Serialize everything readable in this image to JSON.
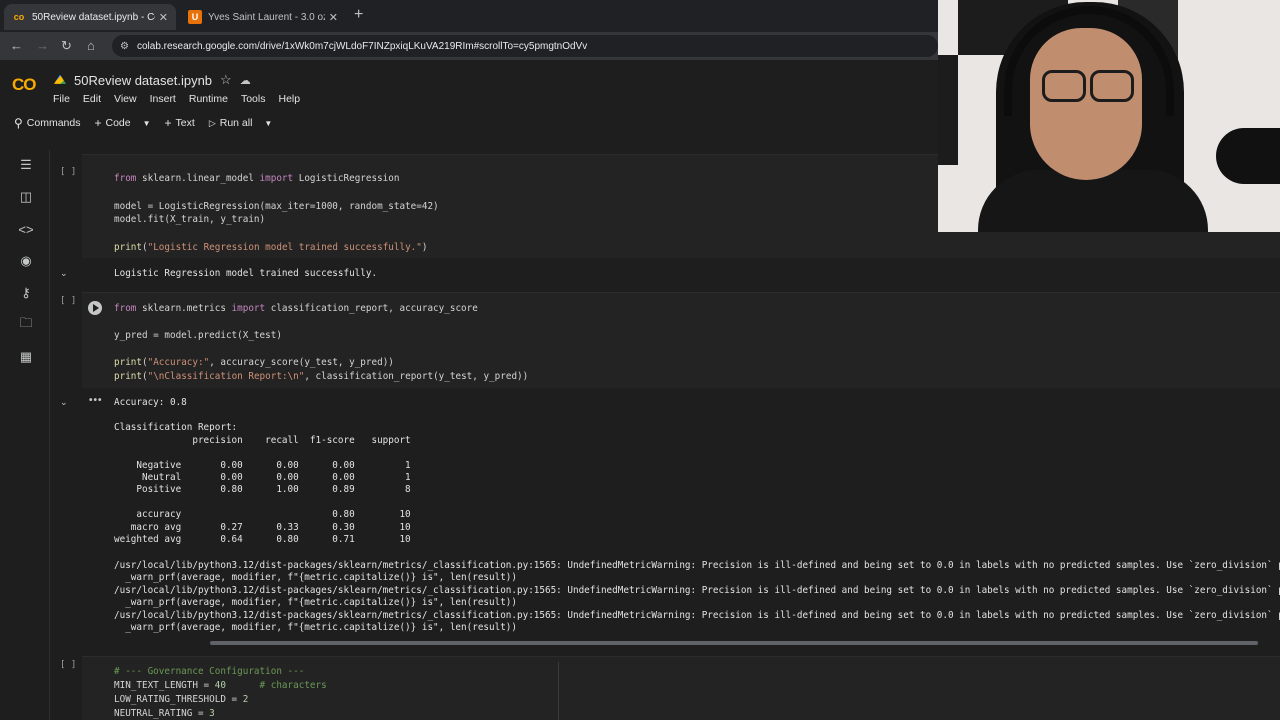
{
  "browser": {
    "tabs": [
      {
        "title": "50Review dataset.ipynb - Colab",
        "active": true
      },
      {
        "title": "Yves Saint Laurent - 3.0 oz Blac",
        "active": false
      }
    ],
    "new_tab_symbol": "+",
    "close_symbol": "✕",
    "url": "colab.research.google.com/drive/1xWk0m7cjWLdoF7INZpxiqLKuVA219RIm#scrollTo=cy5pmgtnOdVv"
  },
  "colab": {
    "logo": "CO",
    "notebook_title": "50Review dataset.ipynb",
    "menus": [
      "File",
      "Edit",
      "View",
      "Insert",
      "Runtime",
      "Tools",
      "Help"
    ],
    "toolbar": {
      "commands": "Commands",
      "code": "Code",
      "text": "Text",
      "run_all": "Run all"
    }
  },
  "cells": {
    "cell1": {
      "bracket": "[ ]",
      "lines": [
        "from sklearn.linear_model import LogisticRegression",
        "model = LogisticRegression(max_iter=1000, random_state=42)",
        "model.fit(X_train, y_train)",
        "print(\"Logistic Regression model trained successfully.\")"
      ],
      "output": "Logistic Regression model trained successfully."
    },
    "cell2": {
      "bracket": "[ ]",
      "lines": [
        "from sklearn.metrics import classification_report, accuracy_score",
        "y_pred = model.predict(X_test)",
        "print(\"Accuracy:\", accuracy_score(y_test, y_pred))",
        "print(\"\\nClassification Report:\\n\", classification_report(y_test, y_pred))"
      ],
      "output_lines": [
        "Accuracy: 0.8",
        "Classification Report:",
        "              precision    recall  f1-score   support",
        "    Negative       0.00      0.00      0.00         1",
        "     Neutral       0.00      0.00      0.00         1",
        "    Positive       0.80      1.00      0.89         8",
        "    accuracy                           0.80        10",
        "   macro avg       0.27      0.33      0.30        10",
        "weighted avg       0.64      0.80      0.71        10",
        "/usr/local/lib/python3.12/dist-packages/sklearn/metrics/_classification.py:1565: UndefinedMetricWarning: Precision is ill-defined and being set to 0.0 in labels with no predicted samples. Use `zero_division` pa",
        "  _warn_prf(average, modifier, f\"{metric.capitalize()} is\", len(result))",
        "/usr/local/lib/python3.12/dist-packages/sklearn/metrics/_classification.py:1565: UndefinedMetricWarning: Precision is ill-defined and being set to 0.0 in labels with no predicted samples. Use `zero_division` pa",
        "  _warn_prf(average, modifier, f\"{metric.capitalize()} is\", len(result))",
        "/usr/local/lib/python3.12/dist-packages/sklearn/metrics/_classification.py:1565: UndefinedMetricWarning: Precision is ill-defined and being set to 0.0 in labels with no predicted samples. Use `zero_division` pa",
        "  _warn_prf(average, modifier, f\"{metric.capitalize()} is\", len(result))"
      ]
    },
    "cell3": {
      "bracket": "[ ]",
      "lines": [
        "# --- Governance Configuration ---",
        "MIN_TEXT_LENGTH = 40      # characters",
        "LOW_RATING_THRESHOLD = 2",
        "NEUTRAL_RATING = 3"
      ]
    }
  },
  "colors": {
    "accent": "#f9ab00",
    "background": "#1e1e1e",
    "keyword": "#c586c0",
    "string": "#ce9178",
    "number": "#b5cea8",
    "comment": "#6a9955"
  }
}
